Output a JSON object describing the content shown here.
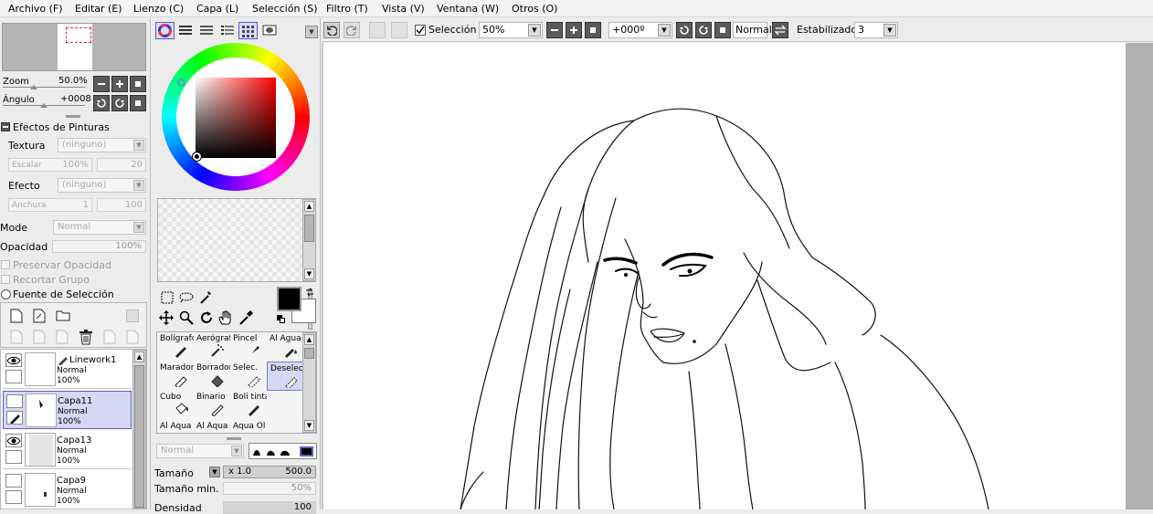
{
  "menu": [
    "Archivo (F)",
    "Editar (E)",
    "Lienzo (C)",
    "Capa (L)",
    "Selección (S)",
    "Filtro (T)",
    "Vista (V)",
    "Ventana (W)",
    "Otros (O)"
  ],
  "navigator": {
    "zoom_label": "Zoom",
    "zoom_value": "50.0%",
    "angle_label": "Ángulo",
    "angle_value": "+0008"
  },
  "paint_effects": {
    "title": "Efectos de Pinturas",
    "texture_label": "Textura",
    "texture_value": "(ninguno)",
    "scale_label": "Escalar",
    "scale_value": "100%",
    "scale_num": "20",
    "effect_label": "Efecto",
    "effect_value": "(ninguno)",
    "width_label": "Anchura",
    "width_value": "1",
    "width_num": "100"
  },
  "layer_props": {
    "mode_label": "Mode",
    "mode_value": "Normal",
    "opacity_label": "Opacidad",
    "opacity_value": "100%",
    "preserve_opacity": "Preservar Opacidad",
    "clip_group": "Recortar Grupo",
    "selection_source": "Fuente de Selección"
  },
  "layers": [
    {
      "name": "Linework1",
      "mode": "Normal",
      "opacity": "100%",
      "visible": true,
      "selected": false
    },
    {
      "name": "Capa11",
      "mode": "Normal",
      "opacity": "100%",
      "visible": false,
      "selected": true
    },
    {
      "name": "Capa13",
      "mode": "Normal",
      "opacity": "100%",
      "visible": true,
      "selected": false
    },
    {
      "name": "Capa9",
      "mode": "Normal",
      "opacity": "100%",
      "visible": false,
      "selected": false
    }
  ],
  "tools": [
    [
      "Bolígrafo",
      "Aerógrafo",
      "Pincel",
      "Al Agua"
    ],
    [
      "Marador",
      "Borrador",
      "Selec.",
      "Deselec."
    ],
    [
      "Cubo",
      "Binario",
      "Boli tinta",
      ""
    ],
    [
      "Al Aqua",
      "Al Aqua",
      "Aqua Ol",
      ""
    ]
  ],
  "brush": {
    "blend_value": "Normal",
    "size_label": "Tamaño",
    "size_mult": "x 1.0",
    "size_value": "500.0",
    "min_size_label": "Tamaño min.",
    "min_size_value": "50%",
    "density_label": "Densidad",
    "density_value": "100"
  },
  "toolbar": {
    "selection_label": "Selección",
    "zoom_value": "50%",
    "rotation_value": "+000º",
    "blend_value": "Normal",
    "stabilizer_label": "Estabilizador",
    "stabilizer_value": "3"
  },
  "colors": {
    "primary": "#000000",
    "secondary": "#ffffff",
    "selection_accent": "#5b5bc8",
    "selected_bg": "#d6d6f5"
  }
}
